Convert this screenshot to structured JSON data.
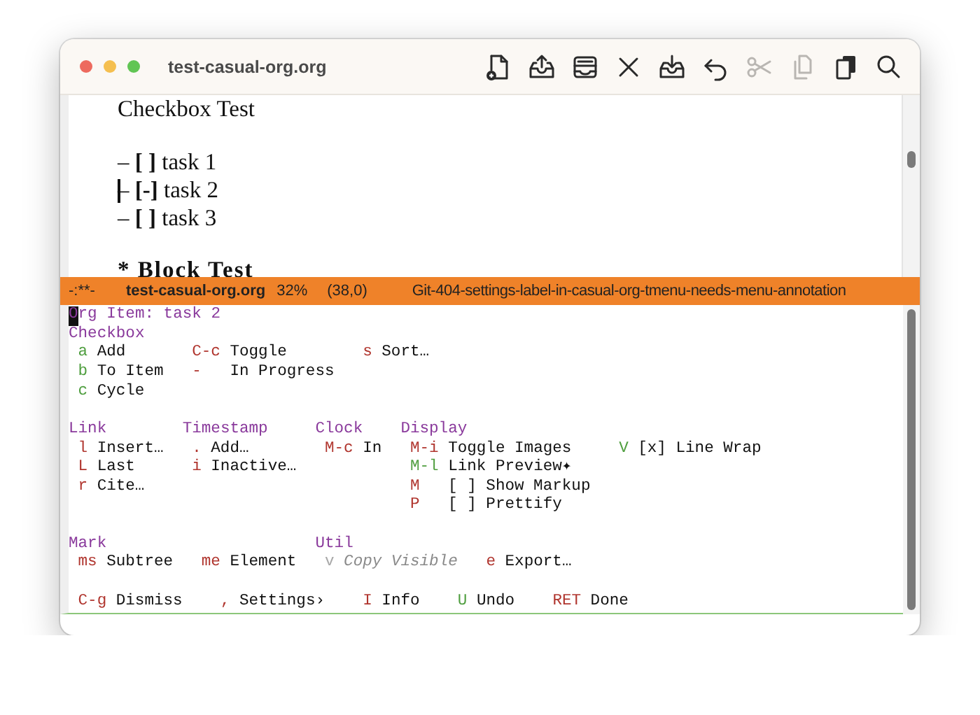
{
  "window": {
    "title": "test-casual-org.org"
  },
  "toolbar": [
    {
      "kind": "newfile",
      "disabled": false
    },
    {
      "kind": "upload",
      "disabled": false
    },
    {
      "kind": "archive",
      "disabled": false
    },
    {
      "kind": "close",
      "disabled": false
    },
    {
      "kind": "download",
      "disabled": false
    },
    {
      "kind": "undo",
      "disabled": false
    },
    {
      "kind": "cut",
      "disabled": true
    },
    {
      "kind": "copy",
      "disabled": true
    },
    {
      "kind": "paste",
      "disabled": false
    },
    {
      "kind": "search",
      "disabled": false
    }
  ],
  "editor": {
    "lines": [
      {
        "text": "Checkbox Test",
        "kind": "plain",
        "cursor": false
      },
      {
        "kind": "blank"
      },
      {
        "text": "– **[ ]** task 1",
        "kind": "plain",
        "cursor": false
      },
      {
        "text": "– **[-]** task 2",
        "kind": "plain",
        "cursor": true
      },
      {
        "text": "– **[ ]** task 3",
        "kind": "plain",
        "cursor": false
      },
      {
        "kind": "blank"
      },
      {
        "text": "* Block Test",
        "kind": "heading",
        "cursor": false
      }
    ]
  },
  "mode_line": {
    "state": "-:**-",
    "buffer": "test-casual-org.org",
    "percent": "32%",
    "position": "(38,0)",
    "branch": "Git-404-settings-label-in-casual-org-tmenu-needs-menu-annotation"
  },
  "transient": {
    "title": "Org Item: task 2",
    "cursor": true,
    "sections": [
      {
        "groups": [
          {
            "heading": "Checkbox",
            "columns": [
              [
                {
                  "key": "a",
                  "label": "Add",
                  "kind": "stay"
                },
                {
                  "key": "b",
                  "label": "To Item",
                  "kind": "stay"
                },
                {
                  "key": "c",
                  "label": "Cycle",
                  "kind": "stay"
                }
              ],
              [
                {
                  "key": "C-c",
                  "label": "Toggle",
                  "kind": "exit"
                },
                {
                  "key": "-",
                  "label": "In Progress",
                  "kind": "exit"
                }
              ],
              [
                {
                  "key": "s",
                  "label": "Sort…",
                  "kind": "exit"
                }
              ]
            ]
          }
        ]
      },
      {
        "groups": [
          {
            "heading": "Link",
            "columns": [
              [
                {
                  "key": "l",
                  "label": "Insert…",
                  "kind": "exit"
                },
                {
                  "key": "L",
                  "label": "Last",
                  "kind": "exit"
                },
                {
                  "key": "r",
                  "label": "Cite…",
                  "kind": "exit"
                }
              ]
            ]
          },
          {
            "heading": "Timestamp",
            "columns": [
              [
                {
                  "key": ".",
                  "label": "Add…",
                  "kind": "exit"
                },
                {
                  "key": "i",
                  "label": "Inactive…",
                  "kind": "exit"
                }
              ]
            ]
          },
          {
            "heading": "Clock",
            "columns": [
              [
                {
                  "key": "M-c",
                  "label": "In",
                  "kind": "exit"
                }
              ]
            ]
          },
          {
            "heading": "Display",
            "columns": [
              [
                {
                  "key": "M-i",
                  "label": "Toggle Images",
                  "kind": "exit"
                },
                {
                  "key": "M-l",
                  "label": "Link Preview✦",
                  "kind": "stay"
                },
                {
                  "key": "M",
                  "label": "[ ] Show Markup",
                  "kind": "exit"
                },
                {
                  "key": "P",
                  "label": "[ ] Prettify",
                  "kind": "exit"
                }
              ],
              [
                {
                  "key": "V",
                  "label": "[x] Line Wrap",
                  "kind": "stay"
                }
              ]
            ]
          }
        ]
      },
      {
        "groups": [
          {
            "heading": "Mark",
            "columns": [
              [
                {
                  "key": "ms",
                  "label": "Subtree",
                  "kind": "exit"
                }
              ],
              [
                {
                  "key": "me",
                  "label": "Element",
                  "kind": "exit"
                }
              ]
            ]
          },
          {
            "heading": "Util",
            "columns": [
              [
                {
                  "key": "v",
                  "label": "Copy Visible",
                  "kind": "disabled"
                }
              ],
              [
                {
                  "key": "e",
                  "label": "Export…",
                  "kind": "exit"
                }
              ]
            ]
          }
        ]
      }
    ],
    "footer": [
      {
        "key": "C-g",
        "label": "Dismiss",
        "kind": "exit"
      },
      {
        "key": ",",
        "label": "Settings›",
        "kind": "exit"
      },
      {
        "key": "I",
        "label": "Info",
        "kind": "exit"
      },
      {
        "key": "U",
        "label": "Undo",
        "kind": "stay"
      },
      {
        "key": "RET",
        "label": "Done",
        "kind": "exit"
      }
    ]
  }
}
